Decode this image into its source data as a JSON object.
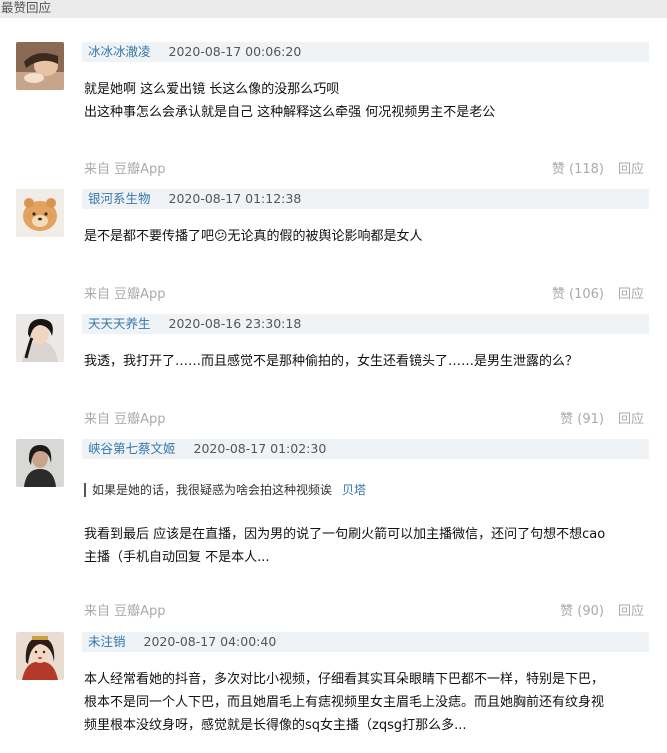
{
  "section_title": "最赞回应",
  "like_label": "赞",
  "reply_label": "回应",
  "comments": [
    {
      "author": "冰冰冰澈凌",
      "time": "2020-08-17 00:06:20",
      "lines": [
        "就是她啊 这么爱出镜 长这么像的没那么巧呗",
        "出这种事怎么会承认就是自己 这种解释这么牵强 何况视频男主不是老公"
      ],
      "source": "来自 豆瓣App",
      "likes": "(118)"
    },
    {
      "author": "银河系生物",
      "time": "2020-08-17 01:12:38",
      "lines": [
        "是不是都不要传播了吧😕无论真的假的被舆论影响都是女人"
      ],
      "source": "来自 豆瓣App",
      "likes": "(106)"
    },
    {
      "author": "天天天养生",
      "time": "2020-08-16 23:30:18",
      "lines": [
        "我透，我打开了……而且感觉不是那种偷拍的，女生还看镜头了……是男生泄露的么？"
      ],
      "source": "来自 豆瓣App",
      "likes": "(91)"
    },
    {
      "author": "峡谷第七蔡文姬",
      "time": "2020-08-17 01:02:30",
      "quote_text": "如果是她的话，我很疑惑为啥会拍这种视频诶",
      "quote_author": "贝塔",
      "lines": [
        "我看到最后 应该是在直播，因为男的说了一句刷火箭可以加主播微信，还问了句想不想cao",
        "主播（手机自动回复 不是本人..."
      ],
      "source": "来自 豆瓣App",
      "likes": "(90)"
    },
    {
      "author": "未注销",
      "time": "2020-08-17 04:00:40",
      "lines": [
        "本人经常看她的抖音，多次对比小视频，仔细看其实耳朵眼睛下巴都不一样，特别是下巴，",
        "根本不是同一个人下巴，而且她眉毛上有痣视频里女主眉毛上没痣。而且她胸前还有纹身视",
        "频里根本没纹身呀，感觉就是长得像的sq女主播（zqsg打那么多..."
      ]
    }
  ]
}
